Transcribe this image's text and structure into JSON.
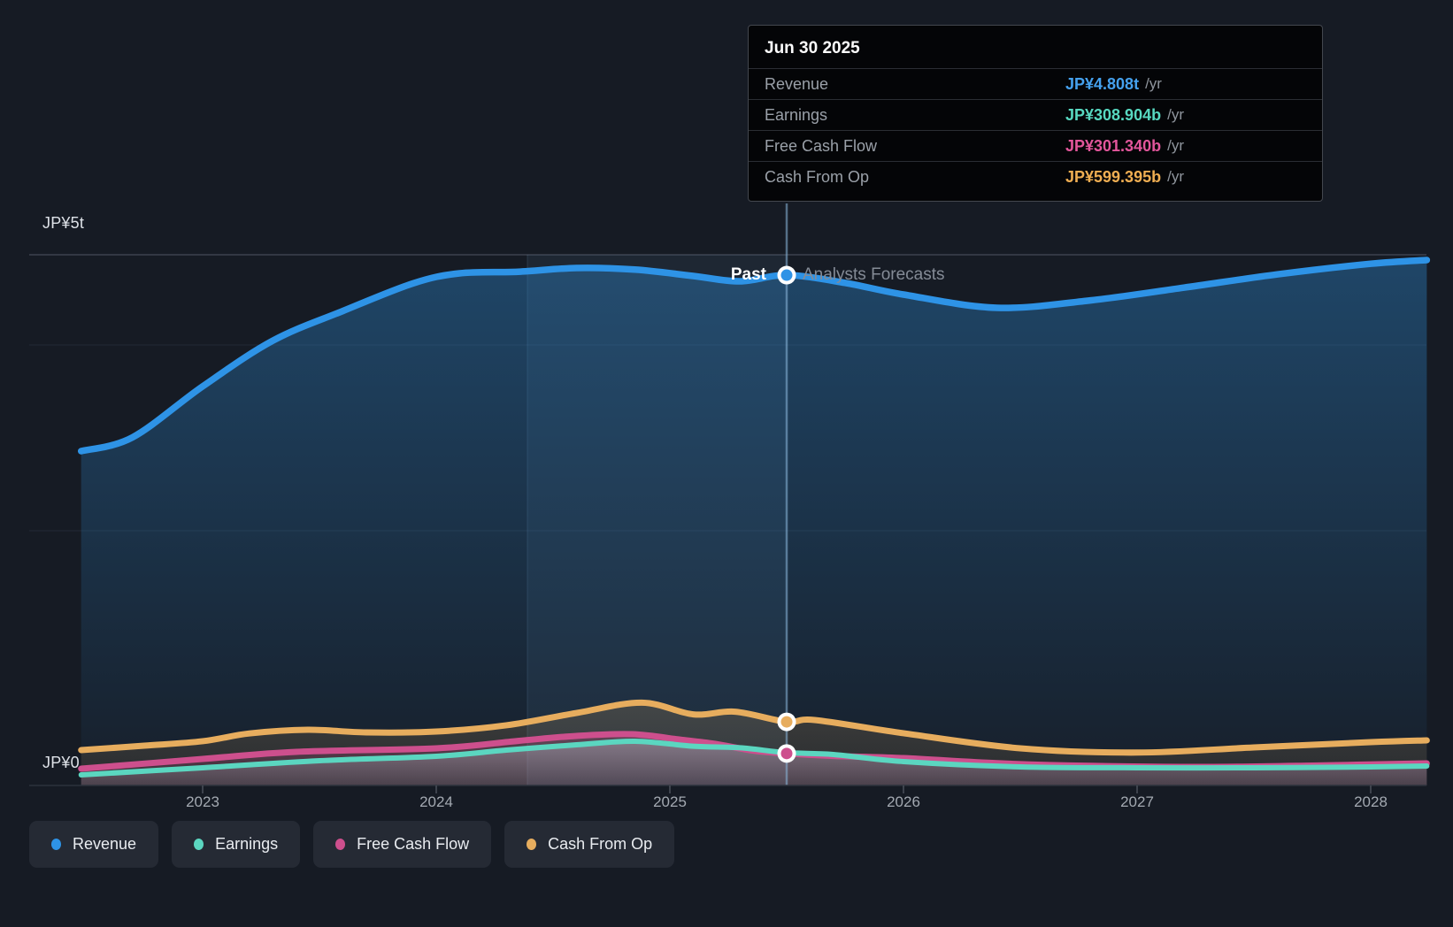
{
  "tooltip": {
    "date": "Jun 30 2025",
    "rows": [
      {
        "label": "Revenue",
        "value": "JP¥4.808t",
        "suffix": "/yr",
        "color": "#45a1ee"
      },
      {
        "label": "Earnings",
        "value": "JP¥308.904b",
        "suffix": "/yr",
        "color": "#57d8c0"
      },
      {
        "label": "Free Cash Flow",
        "value": "JP¥301.340b",
        "suffix": "/yr",
        "color": "#e2569b"
      },
      {
        "label": "Cash From Op",
        "value": "JP¥599.395b",
        "suffix": "/yr",
        "color": "#efae52"
      }
    ]
  },
  "axis": {
    "y_top": "JP¥5t",
    "y_zero": "JP¥0",
    "x_labels": [
      "2023",
      "2024",
      "2025",
      "2026",
      "2027",
      "2028"
    ]
  },
  "annotations": {
    "past": "Past",
    "forecast": "Analysts Forecasts"
  },
  "legend": [
    {
      "label": "Revenue",
      "color": "#2e93e6"
    },
    {
      "label": "Earnings",
      "color": "#5bd6c0"
    },
    {
      "label": "Free Cash Flow",
      "color": "#cd4f8d"
    },
    {
      "label": "Cash From Op",
      "color": "#e7ad5e"
    }
  ],
  "chart_data": {
    "type": "area",
    "title": "Past performance and analyst forecasts",
    "x_unit": "year",
    "x_range": [
      2022.48,
      2028.24
    ],
    "x_tick_years": [
      2023,
      2024,
      2025,
      2026,
      2027,
      2028
    ],
    "divider_x": 2025.5,
    "divider_date": "Jun 30 2025",
    "ylim_billions": [
      0,
      5000
    ],
    "y_gridline_billions": [
      5000,
      0
    ],
    "highlight_band_x": [
      2024.39,
      2025.5
    ],
    "series": [
      {
        "name": "Revenue",
        "color": "#2e93e6",
        "width": 7.5,
        "points": [
          [
            2022.48,
            3150
          ],
          [
            2022.7,
            3280
          ],
          [
            2023.0,
            3760
          ],
          [
            2023.3,
            4190
          ],
          [
            2023.6,
            4470
          ],
          [
            2023.9,
            4730
          ],
          [
            2024.1,
            4825
          ],
          [
            2024.35,
            4840
          ],
          [
            2024.6,
            4875
          ],
          [
            2024.85,
            4860
          ],
          [
            2025.1,
            4800
          ],
          [
            2025.3,
            4750
          ],
          [
            2025.5,
            4808
          ],
          [
            2025.75,
            4735
          ],
          [
            2026.0,
            4625
          ],
          [
            2026.4,
            4500
          ],
          [
            2026.8,
            4570
          ],
          [
            2027.2,
            4690
          ],
          [
            2027.6,
            4815
          ],
          [
            2028.0,
            4915
          ],
          [
            2028.24,
            4950
          ]
        ]
      },
      {
        "name": "Cash From Op",
        "color": "#e7ad5e",
        "width": 7,
        "points": [
          [
            2022.48,
            333
          ],
          [
            2022.75,
            375
          ],
          [
            2023.0,
            417
          ],
          [
            2023.2,
            490
          ],
          [
            2023.45,
            525
          ],
          [
            2023.7,
            500
          ],
          [
            2024.0,
            508
          ],
          [
            2024.3,
            567
          ],
          [
            2024.6,
            683
          ],
          [
            2024.88,
            780
          ],
          [
            2025.1,
            670
          ],
          [
            2025.28,
            695
          ],
          [
            2025.5,
            599
          ],
          [
            2025.62,
            617
          ],
          [
            2026.0,
            492
          ],
          [
            2026.5,
            350
          ],
          [
            2027.0,
            310
          ],
          [
            2027.5,
            358
          ],
          [
            2028.0,
            408
          ],
          [
            2028.24,
            425
          ]
        ]
      },
      {
        "name": "Free Cash Flow",
        "color": "#cd4f8d",
        "width": 7,
        "points": [
          [
            2022.48,
            158
          ],
          [
            2023.0,
            250
          ],
          [
            2023.4,
            317
          ],
          [
            2024.0,
            350
          ],
          [
            2024.35,
            420
          ],
          [
            2024.6,
            467
          ],
          [
            2024.84,
            483
          ],
          [
            2025.05,
            430
          ],
          [
            2025.2,
            390
          ],
          [
            2025.35,
            330
          ],
          [
            2025.5,
            301
          ],
          [
            2025.7,
            278
          ],
          [
            2026.0,
            258
          ],
          [
            2026.4,
            210
          ],
          [
            2026.8,
            185
          ],
          [
            2027.3,
            175
          ],
          [
            2027.8,
            190
          ],
          [
            2028.24,
            208
          ]
        ]
      },
      {
        "name": "Earnings",
        "color": "#5bd6c0",
        "width": 6,
        "points": [
          [
            2022.48,
            100
          ],
          [
            2023.0,
            167
          ],
          [
            2023.5,
            233
          ],
          [
            2024.0,
            275
          ],
          [
            2024.3,
            333
          ],
          [
            2024.6,
            383
          ],
          [
            2024.85,
            417
          ],
          [
            2025.1,
            370
          ],
          [
            2025.3,
            355
          ],
          [
            2025.5,
            309
          ],
          [
            2025.7,
            292
          ],
          [
            2026.0,
            225
          ],
          [
            2026.5,
            175
          ],
          [
            2027.0,
            167
          ],
          [
            2027.5,
            167
          ],
          [
            2028.0,
            175
          ],
          [
            2028.24,
            183
          ]
        ]
      }
    ],
    "markers_at_divider": [
      {
        "series": "Revenue",
        "value_billions": 4808,
        "color": "#2e93e6"
      },
      {
        "series": "Cash From Op",
        "value_billions": 599.395,
        "color": "#e7ad5e"
      },
      {
        "series": "Free Cash Flow",
        "value_billions": 301.34,
        "color": "#cd4f8d"
      }
    ]
  }
}
